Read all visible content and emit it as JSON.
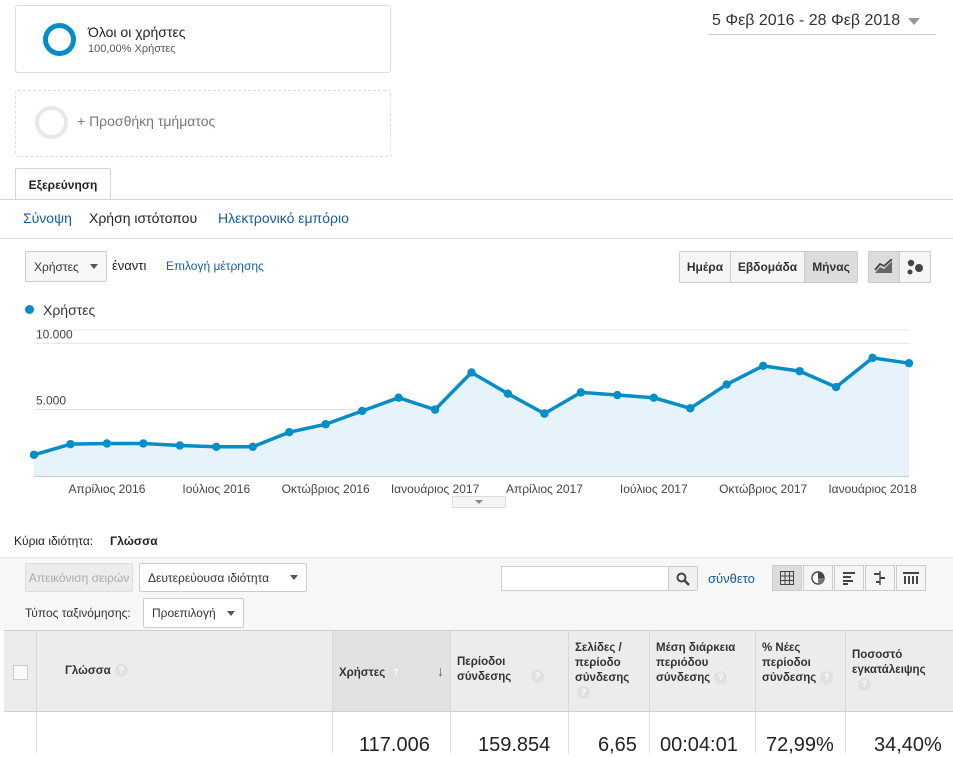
{
  "date_range": "5 Φεβ 2016 - 28 Φεβ 2018",
  "segments": [
    {
      "name": "Όλοι οι χρήστες",
      "sub": "100,00% Χρήστες"
    },
    {
      "name": "+ Προσθήκη τμήματος"
    }
  ],
  "tab": "Εξερεύνηση",
  "subtabs": [
    "Σύνοψη",
    "Χρήση ιστότοπου",
    "Ηλεκτρονικό εμπόριο"
  ],
  "metric_select": "Χρήστες",
  "vs_label": "έναντι",
  "select_metric_link": "Επιλογή μέτρησης",
  "granularity": [
    "Ημέρα",
    "Εβδομάδα",
    "Μήνας"
  ],
  "granularity_selected": "Μήνας",
  "legend_label": "Χρήστες",
  "chart_data": {
    "type": "area",
    "series": [
      {
        "name": "Χρήστες",
        "color": "#058dc7",
        "values": [
          1600,
          2400,
          2450,
          2450,
          2300,
          2200,
          2200,
          3300,
          3900,
          4900,
          5900,
          5000,
          7800,
          6200,
          4700,
          6300,
          6100,
          5900,
          5100,
          6900,
          8300,
          7900,
          6700,
          8900,
          8500
        ]
      }
    ],
    "y_ticks": [
      "10.000",
      "5.000"
    ],
    "ylim": [
      0,
      10000
    ],
    "x_tick_labels": [
      "Απρίλιος 2016",
      "Ιούλιος 2016",
      "Οκτώβριος 2016",
      "Ιανουάριος 2017",
      "Απρίλιος 2017",
      "Ιούλιος 2017",
      "Οκτώβριος 2017",
      "Ιανουάριος 2018"
    ],
    "grid": true
  },
  "primary_dimension_label": "Κύρια ιδιότητα:",
  "primary_dimension_value": "Γλώσσα",
  "plot_rows_button": "Απεικόνιση σειρών",
  "secondary_dimension": "Δευτερεύουσα ιδιότητα",
  "search_placeholder": "",
  "advanced_link": "σύνθετο",
  "sort_type_label": "Τύπος ταξινόμησης:",
  "sort_type_value": "Προεπιλογή",
  "table": {
    "columns": [
      "Γλώσσα",
      "Χρήστες",
      "Περίοδοι σύνδεσης",
      "Σελίδες / περίοδο σύνδεσης",
      "Μέση διάρκεια περιόδου σύνδεσης",
      "% Νέες περίοδοι σύνδεσης",
      "Ποσοστό εγκατάλειψης"
    ],
    "totals": [
      "117.006",
      "159.854",
      "6,65",
      "00:04:01",
      "72,99%",
      "34,40%"
    ]
  },
  "colors": {
    "accent": "#058dc7",
    "link": "#1a5c93",
    "area_fill": "#e6f3fa"
  }
}
